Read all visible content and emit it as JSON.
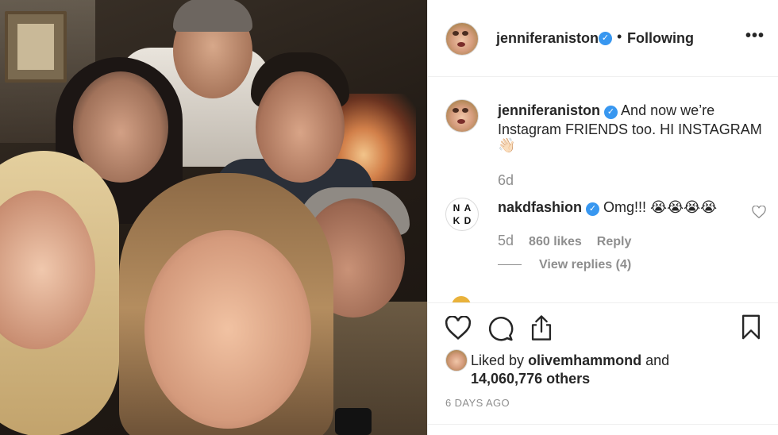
{
  "post": {
    "header": {
      "username": "jenniferaniston",
      "verified_glyph": "✓",
      "separator": "•",
      "follow_status": "Following",
      "more_label": "•••"
    },
    "caption": {
      "username": "jenniferaniston",
      "text": "And now we’re Instagram FRIENDS too. HI INSTAGRAM",
      "emoji": "👋🏻",
      "time": "6d"
    },
    "comments": [
      {
        "username": "nakdfashion",
        "logo_letters": [
          "N",
          "A",
          "K",
          "D"
        ],
        "text": "Omg!!! 😭😭😭😭",
        "time": "5d",
        "likes": "860 likes",
        "reply_label": "Reply",
        "view_replies": "View replies (4)"
      }
    ],
    "actions": {
      "like_icon": "heart-icon",
      "comment_icon": "comment-bubble-icon",
      "share_icon": "share-icon",
      "save_icon": "bookmark-icon"
    },
    "likes": {
      "prefix": "Liked by",
      "user": "olivemhammond",
      "conjunction": "and",
      "others": "14,060,776 others"
    },
    "date": "6 DAYS AGO"
  },
  "colors": {
    "verified": "#3897f0",
    "text": "#262626",
    "muted": "#8e8e8e",
    "divider": "#efefef"
  }
}
